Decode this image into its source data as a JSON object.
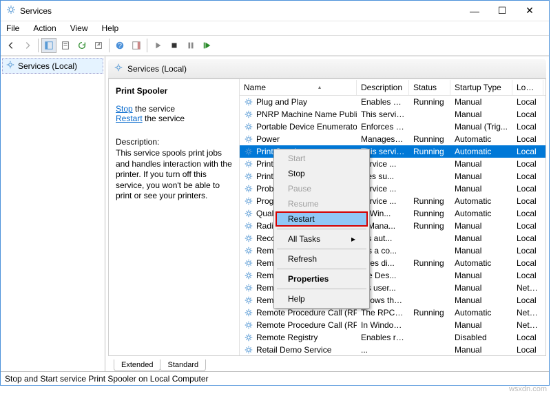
{
  "window": {
    "title": "Services"
  },
  "menubar": [
    "File",
    "Action",
    "View",
    "Help"
  ],
  "left_tree": {
    "label": "Services (Local)"
  },
  "right_header": "Services (Local)",
  "detail": {
    "selected_name": "Print Spooler",
    "stop_link": "Stop",
    "stop_suffix": " the service",
    "restart_link": "Restart",
    "restart_suffix": " the service",
    "desc_label": "Description:",
    "desc_text": "This service spools print jobs and handles interaction with the printer. If you turn off this service, you won't be able to print or see your printers."
  },
  "columns": {
    "name": "Name",
    "description": "Description",
    "status": "Status",
    "startup": "Startup Type",
    "logon": "Log O"
  },
  "rows": [
    {
      "name": "Plug and Play",
      "desc": "Enables a c...",
      "status": "Running",
      "startup": "Manual",
      "logon": "Local"
    },
    {
      "name": "PNRP Machine Name Publi...",
      "desc": "This service ...",
      "status": "",
      "startup": "Manual",
      "logon": "Local"
    },
    {
      "name": "Portable Device Enumerator...",
      "desc": "Enforces gr...",
      "status": "",
      "startup": "Manual (Trig...",
      "logon": "Local"
    },
    {
      "name": "Power",
      "desc": "Manages p...",
      "status": "Running",
      "startup": "Automatic",
      "logon": "Local"
    },
    {
      "name": "Print Spooler",
      "desc": "This service ...",
      "status": "Running",
      "startup": "Automatic",
      "logon": "Local",
      "selected": true
    },
    {
      "name": "Printer E",
      "desc": "service ...",
      "status": "",
      "startup": "Manual",
      "logon": "Local"
    },
    {
      "name": "PrintWo",
      "desc": "ides su...",
      "status": "",
      "startup": "Manual",
      "logon": "Local"
    },
    {
      "name": "Problen",
      "desc": "service ...",
      "status": "",
      "startup": "Manual",
      "logon": "Local"
    },
    {
      "name": "Progran",
      "desc": "service ...",
      "status": "Running",
      "startup": "Automatic",
      "logon": "Local"
    },
    {
      "name": "Quality",
      "desc": "ty Win...",
      "status": "Running",
      "startup": "Automatic",
      "logon": "Local"
    },
    {
      "name": "Radio M",
      "desc": "o Mana...",
      "status": "Running",
      "startup": "Manual",
      "logon": "Local"
    },
    {
      "name": "Recomr",
      "desc": "les aut...",
      "status": "",
      "startup": "Manual",
      "logon": "Local"
    },
    {
      "name": "Remote",
      "desc": "tes a co...",
      "status": "",
      "startup": "Manual",
      "logon": "Local"
    },
    {
      "name": "Remote",
      "desc": "ages di...",
      "status": "Running",
      "startup": "Automatic",
      "logon": "Local"
    },
    {
      "name": "Remote",
      "desc": "ote Des...",
      "status": "",
      "startup": "Manual",
      "logon": "Local"
    },
    {
      "name": "Remote Desktop Services",
      "desc": "ws user...",
      "status": "",
      "startup": "Manual",
      "logon": "Netwo"
    },
    {
      "name": "Remote Desktop Services U...",
      "desc": "Allows the r...",
      "status": "",
      "startup": "Manual",
      "logon": "Local"
    },
    {
      "name": "Remote Procedure Call (RPC)",
      "desc": "The RPCSS s...",
      "status": "Running",
      "startup": "Automatic",
      "logon": "Netwo"
    },
    {
      "name": "Remote Procedure Call (RP...",
      "desc": "In Windows...",
      "status": "",
      "startup": "Manual",
      "logon": "Netwo"
    },
    {
      "name": "Remote Registry",
      "desc": "Enables rem...",
      "status": "",
      "startup": "Disabled",
      "logon": "Local"
    },
    {
      "name": "Retail Demo Service",
      "desc": "...",
      "status": "",
      "startup": "Manual",
      "logon": "Local"
    }
  ],
  "tabs_bottom": {
    "extended": "Extended",
    "standard": "Standard"
  },
  "statusbar": "Stop and Start service Print Spooler on Local Computer",
  "context_menu": {
    "start": "Start",
    "stop": "Stop",
    "pause": "Pause",
    "resume": "Resume",
    "restart": "Restart",
    "all_tasks": "All Tasks",
    "refresh": "Refresh",
    "properties": "Properties",
    "help": "Help"
  },
  "watermark": "wsxdn.com"
}
